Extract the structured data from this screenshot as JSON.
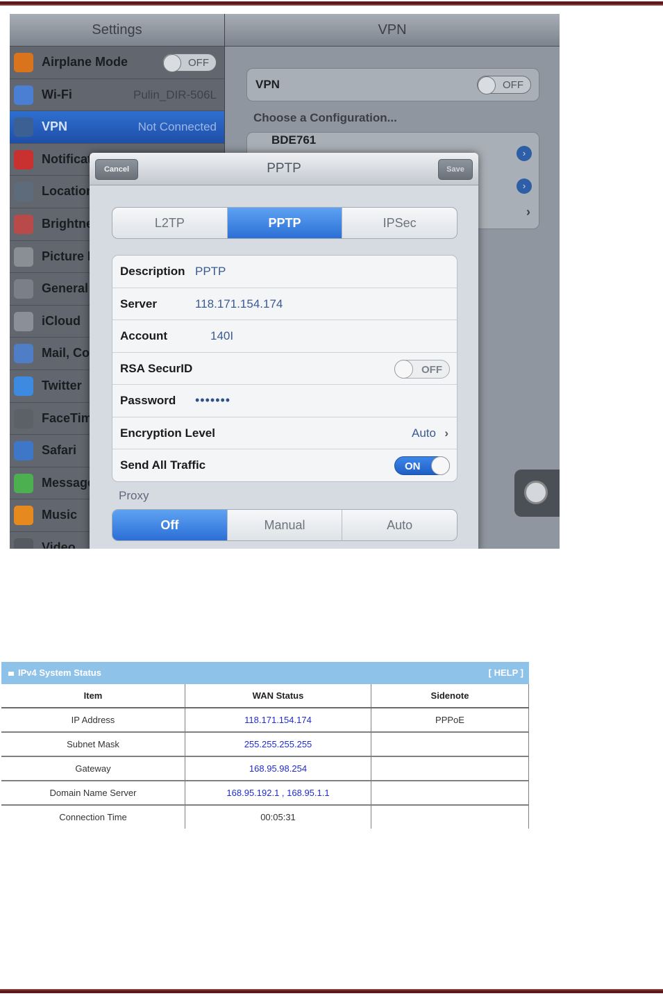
{
  "settings": {
    "title": "Settings",
    "items": [
      {
        "label": "Airplane Mode",
        "toggle": "OFF",
        "icon": "airplane-icon",
        "color": "#d9741c"
      },
      {
        "label": "Wi-Fi",
        "value": "Pulin_DIR-506L",
        "icon": "wifi-icon",
        "color": "#4a7fd4"
      },
      {
        "label": "VPN",
        "value": "Not Connected",
        "icon": "vpn-icon",
        "color": "#3c5f94",
        "selected": true
      },
      {
        "label": "Notificat",
        "icon": "notifications-icon",
        "color": "#c93030"
      },
      {
        "label": "Location",
        "icon": "location-icon",
        "color": "#5e6b7a"
      },
      {
        "label": "Brightne",
        "icon": "brightness-icon",
        "color": "#b84a4a"
      },
      {
        "label": "Picture F",
        "icon": "picture-frame-icon",
        "color": "#8a8f96"
      },
      {
        "label": "General",
        "icon": "gear-icon",
        "color": "#7b8088"
      },
      {
        "label": "iCloud",
        "icon": "cloud-icon",
        "color": "#8a9098"
      },
      {
        "label": "Mail, Co",
        "icon": "mail-icon",
        "color": "#4f7ec6"
      },
      {
        "label": "Twitter",
        "icon": "twitter-icon",
        "color": "#3d8be0"
      },
      {
        "label": "FaceTim",
        "icon": "facetime-icon",
        "color": "#5c6168"
      },
      {
        "label": "Safari",
        "icon": "safari-icon",
        "color": "#3f77c8"
      },
      {
        "label": "Message",
        "icon": "messages-icon",
        "color": "#4caf50"
      },
      {
        "label": "Music",
        "icon": "music-icon",
        "color": "#e68a1f"
      },
      {
        "label": "Video",
        "icon": "video-icon",
        "color": "#555a61"
      }
    ]
  },
  "vpn": {
    "title": "VPN",
    "label": "VPN",
    "toggle": "OFF",
    "choose": "Choose a Configuration...",
    "config_name": "BDE761"
  },
  "modal": {
    "title": "PPTP",
    "cancel": "Cancel",
    "save": "Save",
    "types": [
      "L2TP",
      "PPTP",
      "IPSec"
    ],
    "selected_type": "PPTP",
    "fields": {
      "description_label": "Description",
      "description_value": "PPTP",
      "server_label": "Server",
      "server_value": "118.171.154.174",
      "account_label": "Account",
      "account_value": "140I",
      "rsa_label": "RSA SecurID",
      "rsa_toggle": "OFF",
      "password_label": "Password",
      "password_value": "•••••••",
      "encryption_label": "Encryption Level",
      "encryption_value": "Auto",
      "traffic_label": "Send All Traffic",
      "traffic_toggle": "ON"
    },
    "proxy_label": "Proxy",
    "proxy_options": [
      "Off",
      "Manual",
      "Auto"
    ],
    "proxy_selected": "Off"
  },
  "status": {
    "title": "IPv4 System Status",
    "help": "[ HELP ]",
    "headers": [
      "Item",
      "WAN Status",
      "Sidenote"
    ],
    "rows": [
      {
        "item": "IP Address",
        "wan": "118.171.154.174",
        "note": "PPPoE"
      },
      {
        "item": "Subnet Mask",
        "wan": "255.255.255.255",
        "note": ""
      },
      {
        "item": "Gateway",
        "wan": "168.95.98.254",
        "note": ""
      },
      {
        "item": "Domain Name Server",
        "wan": "168.95.192.1 , 168.95.1.1",
        "note": ""
      },
      {
        "item": "Connection Time",
        "wan": "00:05:31",
        "note": ""
      }
    ]
  }
}
